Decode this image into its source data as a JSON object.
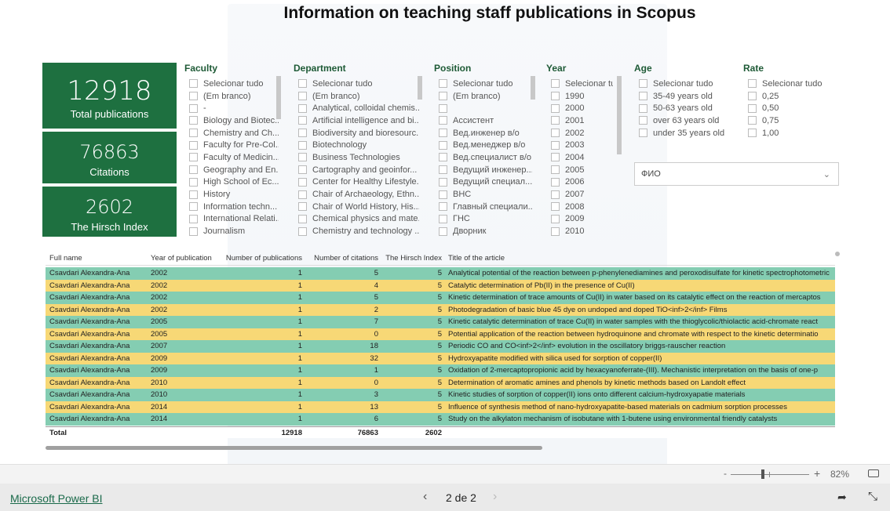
{
  "title": "Information on teaching staff publications in Scopus",
  "colors": {
    "card": "#1e7040",
    "row_teal": "#84cdb2",
    "row_yellow": "#f7d876"
  },
  "cards": [
    {
      "value": "12918",
      "label": "Total publications"
    },
    {
      "value": "76863",
      "label": "Citations"
    },
    {
      "value": "2602",
      "label": "The Hirsch Index"
    }
  ],
  "slicers": [
    {
      "title": "Faculty",
      "items": [
        "Selecionar tudo",
        "(Em branco)",
        "-",
        "Biology and Biotec...",
        "Chemistry and Ch...",
        "Faculty for Pre-Col...",
        "Faculty of Medicin...",
        "Geography and En...",
        "High School of Ec...",
        "History",
        "Information techn...",
        "International Relati...",
        "Journalism"
      ]
    },
    {
      "title": "Department",
      "items": [
        "Selecionar tudo",
        "(Em branco)",
        "Analytical, colloidal chemis...",
        "Artificial intelligence and bi...",
        "Biodiversity and bioresourc...",
        "Biotechnology",
        "Business Technologies",
        "Cartography and geoinfor...",
        "Center for Healthy Lifestyle...",
        "Chair of Archaeology, Ethn...",
        "Chair of World History, His...",
        "Chemical physics and mate...",
        "Chemistry and technology ..."
      ]
    },
    {
      "title": "Position",
      "items": [
        "Selecionar tudo",
        "(Em branco)",
        "",
        "Ассистент",
        "Вед.инженер в/о",
        "Вед.менеджер в/о",
        "Вед.специалист в/о",
        "Ведущий инженер...",
        "Ведущий специал...",
        "ВНС",
        "Главный специали...",
        "ГНС",
        "Дворник"
      ]
    },
    {
      "title": "Year",
      "items": [
        "Selecionar tu...",
        "1990",
        "2000",
        "2001",
        "2002",
        "2003",
        "2004",
        "2005",
        "2006",
        "2007",
        "2008",
        "2009",
        "2010"
      ]
    },
    {
      "title": "Age",
      "items": [
        "Selecionar tudo",
        "35-49 years old",
        "50-63 years old",
        "over 63 years old",
        "under 35 years old"
      ]
    },
    {
      "title": "Rate",
      "items": [
        "Selecionar tudo",
        "0,25",
        "0,50",
        "0,75",
        "1,00"
      ]
    }
  ],
  "fio_dropdown": {
    "placeholder": "ФИО"
  },
  "table": {
    "columns": [
      "Full name",
      "Year of publication",
      "Number of publications",
      "Number of citations",
      "The Hirsch Index",
      "Title of the article"
    ],
    "rows": [
      [
        "Csavdari Alexandra-Ana",
        "2002",
        "1",
        "5",
        "5",
        "Analytical potential of the reaction between p-phenylenediamines and peroxodisulfate for kinetic spectrophotometric"
      ],
      [
        "Csavdari Alexandra-Ana",
        "2002",
        "1",
        "4",
        "5",
        "Catalytic determination of Pb(II) in the presence of Cu(II)"
      ],
      [
        "Csavdari Alexandra-Ana",
        "2002",
        "1",
        "5",
        "5",
        "Kinetic determination of trace amounts of Cu(II) in water based on its catalytic effect on the reaction of mercaptos"
      ],
      [
        "Csavdari Alexandra-Ana",
        "2002",
        "1",
        "2",
        "5",
        "Photodegradation of basic blue 45 dye on undoped and doped TiO<inf>2</inf> Films"
      ],
      [
        "Csavdari Alexandra-Ana",
        "2005",
        "1",
        "7",
        "5",
        "Kinetic catalytic determination of trace Cu(II) in water samples with the thioglycolic/thiolactic acid-chromate react"
      ],
      [
        "Csavdari Alexandra-Ana",
        "2005",
        "1",
        "0",
        "5",
        "Potential application of the reaction between hydroquinone and chromate with respect to the kinetic determinatio"
      ],
      [
        "Csavdari Alexandra-Ana",
        "2007",
        "1",
        "18",
        "5",
        "Periodic CO and CO<inf>2</inf> evolution in the oscillatory briggs-rauscher reaction"
      ],
      [
        "Csavdari Alexandra-Ana",
        "2009",
        "1",
        "32",
        "5",
        "Hydroxyapatite modified with silica used for sorption of copper(II)"
      ],
      [
        "Csavdari Alexandra-Ana",
        "2009",
        "1",
        "1",
        "5",
        "Oxidation of 2-mercaptopropionic acid by hexacyanoferrate-(III). Mechanistic interpretation on the basis of one-p"
      ],
      [
        "Csavdari Alexandra-Ana",
        "2010",
        "1",
        "0",
        "5",
        "Determination of aromatic amines and phenols by kinetic methods based on Landolt effect"
      ],
      [
        "Csavdari Alexandra-Ana",
        "2010",
        "1",
        "3",
        "5",
        "Kinetic studies of sorption of copper(II) ions onto different calcium-hydroxyapatie materials"
      ],
      [
        "Csavdari Alexandra-Ana",
        "2014",
        "1",
        "13",
        "5",
        "Influence of synthesis method of nano-hydroxyapatite-based materials on cadmium sorption processes"
      ],
      [
        "Csavdari Alexandra-Ana",
        "2014",
        "1",
        "6",
        "5",
        "Study on the alkylaton mechanism of isobutane with 1-butene using environmental friendly catalysts"
      ]
    ],
    "total": {
      "label": "Total",
      "publications": "12918",
      "citations": "76863",
      "hirsch": "2602"
    }
  },
  "zoom": {
    "minus": "-",
    "plus": "+",
    "level": "82%",
    "value_percent": 82
  },
  "footer": {
    "link": "Microsoft Power BI",
    "page": "2 de 2"
  }
}
